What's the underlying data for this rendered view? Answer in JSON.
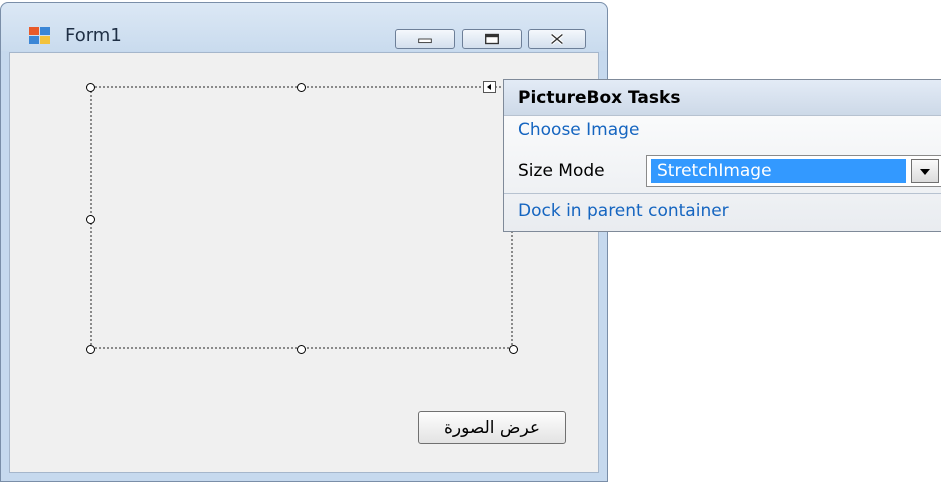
{
  "window": {
    "title": "Form1",
    "accent_color": "#c6d9ee"
  },
  "form": {
    "button_label": "عرض الصورة"
  },
  "designer": {
    "smart_tag_icon": "smart-tag-arrow-icon"
  },
  "tasks_panel": {
    "title": "PictureBox Tasks",
    "choose_image_label": "Choose Image",
    "size_mode_label": "Size Mode",
    "size_mode_value": "StretchImage",
    "dock_label": "Dock in parent container",
    "link_color": "#1565c0"
  }
}
